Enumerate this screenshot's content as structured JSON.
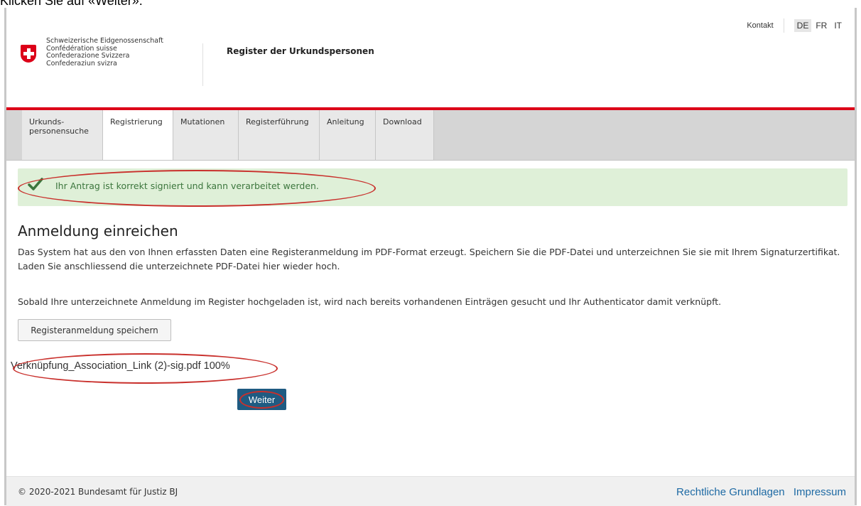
{
  "instruction": "Klicken Sie auf «Weiter».",
  "header": {
    "contact": "Kontakt",
    "languages": [
      "DE",
      "FR",
      "IT"
    ],
    "confederation": [
      "Schweizerische Eidgenossenschaft",
      "Confédération suisse",
      "Confederazione Svizzera",
      "Confederaziun svizra"
    ],
    "site_title": "Register der Urkundspersonen"
  },
  "nav": {
    "items": [
      {
        "label": "Urkunds-\npersonensuche"
      },
      {
        "label": "Registrierung"
      },
      {
        "label": "Mutationen"
      },
      {
        "label": "Registerführung"
      },
      {
        "label": "Anleitung"
      },
      {
        "label": "Download"
      }
    ],
    "active": "Registrierung"
  },
  "alert": {
    "icon": "check-icon",
    "text": "Ihr Antrag ist korrekt signiert und kann verarbeitet werden."
  },
  "main": {
    "title": "Anmeldung einreichen",
    "paragraph1": "Das System hat aus den von Ihnen erfassten Daten eine Registeranmeldung im PDF-Format erzeugt. Speichern Sie die PDF-Datei und unterzeichnen Sie sie mit Ihrem Signaturzertifikat. Laden Sie anschliessend die unterzeichnete PDF-Datei hier wieder hoch.",
    "paragraph2": "Sobald Ihre unterzeichnete Anmeldung im Register hochgeladen ist, wird nach bereits vorhandenen Einträgen gesucht und Ihr Authenticator damit verknüpft.",
    "save_button": "Registeranmeldung speichern",
    "uploaded_file": "Verknüpfung_Association_Link (2)-sig.pdf 100%",
    "next_button": "Weiter"
  },
  "footer": {
    "copyright": "© 2020-2021 Bundesamt für Justiz BJ",
    "links": [
      "Rechtliche Grundlagen",
      "Impressum"
    ]
  },
  "colors": {
    "brand_red": "#dc0018",
    "success_bg": "#dff0d8",
    "success_text": "#3c763d",
    "primary_button": "#1f5b82",
    "link": "#1e6aa4",
    "annotation": "#c9302c"
  }
}
